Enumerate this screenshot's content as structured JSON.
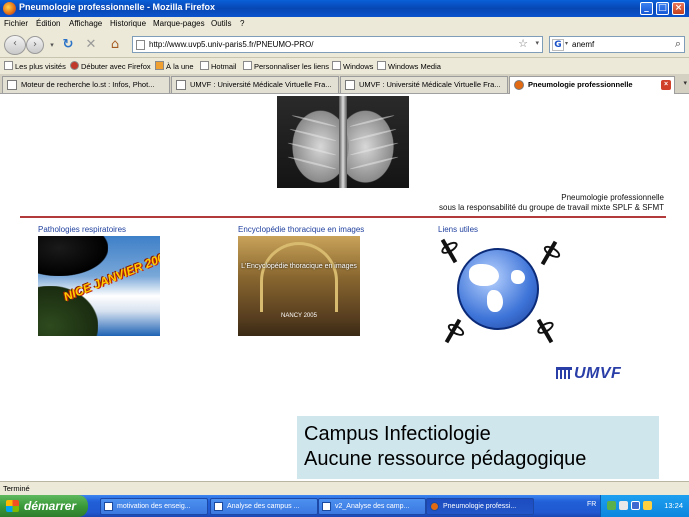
{
  "window": {
    "title": "Pneumologie professionnelle - Mozilla Firefox"
  },
  "menu": [
    "Fichier",
    "Édition",
    "Affichage",
    "Historique",
    "Marque-pages",
    "Outils",
    "?"
  ],
  "nav": {
    "url": "http://www.uvp5.univ-paris5.fr/PNEUMO-PRO/",
    "search_value": "anemf"
  },
  "bookmarks": [
    "Les plus visités",
    "Débuter avec Firefox",
    "À la une",
    "Hotmail",
    "Personnaliser les liens",
    "Windows",
    "Windows Media"
  ],
  "tabs": [
    {
      "label": "Moteur de recherche lo.st : Infos, Phot..."
    },
    {
      "label": "UMVF : Université Médicale Virtuelle Fra..."
    },
    {
      "label": "UMVF : Université Médicale Virtuelle Fra..."
    },
    {
      "label": "Pneumologie professionnelle"
    }
  ],
  "page": {
    "caption_line1": "Pneumologie professionnelle",
    "caption_line2": "sous la responsabilité du groupe de travail mixte SPLF & SFMT",
    "sections": [
      {
        "title": "Pathologies respiratoires",
        "thumb_text": "NICE JANVIER 2004"
      },
      {
        "title": "Encyclopédie thoracique en images",
        "thumb_text": "L'Encyclopédie thoracique en images",
        "thumb_date": "NANCY 2005"
      },
      {
        "title": "Liens utiles"
      }
    ],
    "logo": "UMVF",
    "campus_line1": "Campus Infectiologie",
    "campus_line2": "Aucune ressource pédagogique"
  },
  "status": "Terminé",
  "taskbar": {
    "start": "démarrer",
    "tasks": [
      "motivation des enseig...",
      "Analyse des campus ...",
      "v2_Analyse des camp...",
      "Pneumologie professi..."
    ],
    "lang": "FR",
    "time": "13:24"
  }
}
